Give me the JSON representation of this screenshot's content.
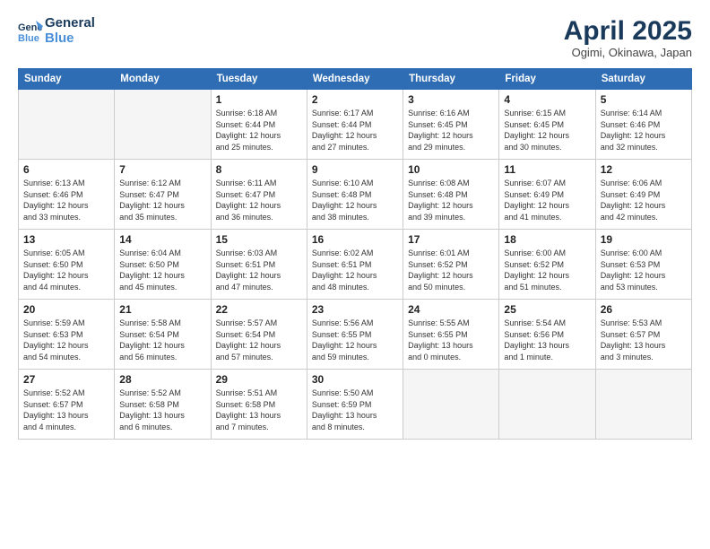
{
  "header": {
    "logo_line1": "General",
    "logo_line2": "Blue",
    "month_year": "April 2025",
    "location": "Ogimi, Okinawa, Japan"
  },
  "weekdays": [
    "Sunday",
    "Monday",
    "Tuesday",
    "Wednesday",
    "Thursday",
    "Friday",
    "Saturday"
  ],
  "weeks": [
    [
      {
        "day": "",
        "detail": ""
      },
      {
        "day": "",
        "detail": ""
      },
      {
        "day": "1",
        "detail": "Sunrise: 6:18 AM\nSunset: 6:44 PM\nDaylight: 12 hours\nand 25 minutes."
      },
      {
        "day": "2",
        "detail": "Sunrise: 6:17 AM\nSunset: 6:44 PM\nDaylight: 12 hours\nand 27 minutes."
      },
      {
        "day": "3",
        "detail": "Sunrise: 6:16 AM\nSunset: 6:45 PM\nDaylight: 12 hours\nand 29 minutes."
      },
      {
        "day": "4",
        "detail": "Sunrise: 6:15 AM\nSunset: 6:45 PM\nDaylight: 12 hours\nand 30 minutes."
      },
      {
        "day": "5",
        "detail": "Sunrise: 6:14 AM\nSunset: 6:46 PM\nDaylight: 12 hours\nand 32 minutes."
      }
    ],
    [
      {
        "day": "6",
        "detail": "Sunrise: 6:13 AM\nSunset: 6:46 PM\nDaylight: 12 hours\nand 33 minutes."
      },
      {
        "day": "7",
        "detail": "Sunrise: 6:12 AM\nSunset: 6:47 PM\nDaylight: 12 hours\nand 35 minutes."
      },
      {
        "day": "8",
        "detail": "Sunrise: 6:11 AM\nSunset: 6:47 PM\nDaylight: 12 hours\nand 36 minutes."
      },
      {
        "day": "9",
        "detail": "Sunrise: 6:10 AM\nSunset: 6:48 PM\nDaylight: 12 hours\nand 38 minutes."
      },
      {
        "day": "10",
        "detail": "Sunrise: 6:08 AM\nSunset: 6:48 PM\nDaylight: 12 hours\nand 39 minutes."
      },
      {
        "day": "11",
        "detail": "Sunrise: 6:07 AM\nSunset: 6:49 PM\nDaylight: 12 hours\nand 41 minutes."
      },
      {
        "day": "12",
        "detail": "Sunrise: 6:06 AM\nSunset: 6:49 PM\nDaylight: 12 hours\nand 42 minutes."
      }
    ],
    [
      {
        "day": "13",
        "detail": "Sunrise: 6:05 AM\nSunset: 6:50 PM\nDaylight: 12 hours\nand 44 minutes."
      },
      {
        "day": "14",
        "detail": "Sunrise: 6:04 AM\nSunset: 6:50 PM\nDaylight: 12 hours\nand 45 minutes."
      },
      {
        "day": "15",
        "detail": "Sunrise: 6:03 AM\nSunset: 6:51 PM\nDaylight: 12 hours\nand 47 minutes."
      },
      {
        "day": "16",
        "detail": "Sunrise: 6:02 AM\nSunset: 6:51 PM\nDaylight: 12 hours\nand 48 minutes."
      },
      {
        "day": "17",
        "detail": "Sunrise: 6:01 AM\nSunset: 6:52 PM\nDaylight: 12 hours\nand 50 minutes."
      },
      {
        "day": "18",
        "detail": "Sunrise: 6:00 AM\nSunset: 6:52 PM\nDaylight: 12 hours\nand 51 minutes."
      },
      {
        "day": "19",
        "detail": "Sunrise: 6:00 AM\nSunset: 6:53 PM\nDaylight: 12 hours\nand 53 minutes."
      }
    ],
    [
      {
        "day": "20",
        "detail": "Sunrise: 5:59 AM\nSunset: 6:53 PM\nDaylight: 12 hours\nand 54 minutes."
      },
      {
        "day": "21",
        "detail": "Sunrise: 5:58 AM\nSunset: 6:54 PM\nDaylight: 12 hours\nand 56 minutes."
      },
      {
        "day": "22",
        "detail": "Sunrise: 5:57 AM\nSunset: 6:54 PM\nDaylight: 12 hours\nand 57 minutes."
      },
      {
        "day": "23",
        "detail": "Sunrise: 5:56 AM\nSunset: 6:55 PM\nDaylight: 12 hours\nand 59 minutes."
      },
      {
        "day": "24",
        "detail": "Sunrise: 5:55 AM\nSunset: 6:55 PM\nDaylight: 13 hours\nand 0 minutes."
      },
      {
        "day": "25",
        "detail": "Sunrise: 5:54 AM\nSunset: 6:56 PM\nDaylight: 13 hours\nand 1 minute."
      },
      {
        "day": "26",
        "detail": "Sunrise: 5:53 AM\nSunset: 6:57 PM\nDaylight: 13 hours\nand 3 minutes."
      }
    ],
    [
      {
        "day": "27",
        "detail": "Sunrise: 5:52 AM\nSunset: 6:57 PM\nDaylight: 13 hours\nand 4 minutes."
      },
      {
        "day": "28",
        "detail": "Sunrise: 5:52 AM\nSunset: 6:58 PM\nDaylight: 13 hours\nand 6 minutes."
      },
      {
        "day": "29",
        "detail": "Sunrise: 5:51 AM\nSunset: 6:58 PM\nDaylight: 13 hours\nand 7 minutes."
      },
      {
        "day": "30",
        "detail": "Sunrise: 5:50 AM\nSunset: 6:59 PM\nDaylight: 13 hours\nand 8 minutes."
      },
      {
        "day": "",
        "detail": ""
      },
      {
        "day": "",
        "detail": ""
      },
      {
        "day": "",
        "detail": ""
      }
    ]
  ]
}
